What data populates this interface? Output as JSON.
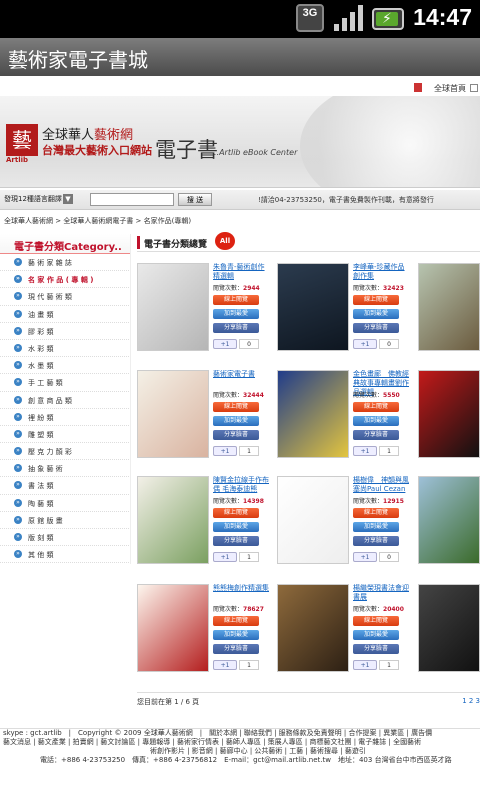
{
  "status_bar": {
    "network": "3G",
    "time": "14:47"
  },
  "app": {
    "title": "藝術家電子書城"
  },
  "top_nav": {
    "home_label": "全球首頁"
  },
  "banner": {
    "logo_text_line1_prefix": "全球華人",
    "logo_text_line1_brand": "藝術網",
    "logo_text_line2": "台灣最大藝術入口網站",
    "logo_small": "Artlib",
    "ebook_title": "電子書",
    "ebook_subtitle": "..Artlib eBook Center"
  },
  "search": {
    "select_value": "發現12種語言翻譯",
    "button_label": "搜 送",
    "phone_notice": "!請洽04-23753250，電子書免費製作刊載，有意將發行"
  },
  "breadcrumb": "全球華人藝術網 > 全球華人藝術網電子書 > 名家作品(專輯)",
  "sidebar": {
    "heading": "電子書分類Category..",
    "items": [
      {
        "label": "藝 術 家 雜 誌",
        "active": false
      },
      {
        "label": "名 家 作 品 ( 專 輯 )",
        "active": true
      },
      {
        "label": "現 代 藝 術 類",
        "active": false
      },
      {
        "label": "油 畫 類",
        "active": false
      },
      {
        "label": "膠 彩 類",
        "active": false
      },
      {
        "label": "水 彩 類",
        "active": false
      },
      {
        "label": "水 墨 類",
        "active": false
      },
      {
        "label": "手 工 藝 類",
        "active": false
      },
      {
        "label": "創 意 商 品 類",
        "active": false
      },
      {
        "label": "裡 紛 類",
        "active": false
      },
      {
        "label": "雕 塑 類",
        "active": false
      },
      {
        "label": "壓 克 力 顏 彩",
        "active": false
      },
      {
        "label": "抽 象 藝 術",
        "active": false
      },
      {
        "label": "書 法 類",
        "active": false
      },
      {
        "label": "陶 藝 類",
        "active": false
      },
      {
        "label": "原 館 版 畫",
        "active": false
      },
      {
        "label": "版 刻 類",
        "active": false
      },
      {
        "label": "其 他 類",
        "active": false
      }
    ]
  },
  "content": {
    "section_title": "電子書分類總覽",
    "all_badge": "All",
    "buttons": {
      "read": "線上閱覽",
      "fav": "加到最愛",
      "fb": "分享臉書",
      "plus": "+1"
    },
    "views_label": "閱覽次數：",
    "books": [
      {
        "title": "朱魯青-藝術創作精選輯",
        "views": "2944",
        "plus_count": "0"
      },
      {
        "title": "李峰華-珍藏作品創作集",
        "views": "32423",
        "plus_count": "0"
      },
      {
        "title": "藝術家電子書",
        "views": "32444",
        "plus_count": "1"
      },
      {
        "title": "金色畫廊　佛教經典故事專輯畫劉作品選輯",
        "views": "5550",
        "plus_count": "1"
      },
      {
        "title": "陳賢金拉線手作布偶 毛海泰迪熊",
        "views": "14398",
        "plus_count": "1"
      },
      {
        "title": "楊樹偉　神韻與風塞尚Paul Cezan",
        "views": "12915",
        "plus_count": "0"
      },
      {
        "title": "熊熊梅創作精選集",
        "views": "78627",
        "plus_count": "1"
      },
      {
        "title": "楊繼榮現書法會迎書展",
        "views": "20400",
        "plus_count": "1"
      }
    ]
  },
  "pager": {
    "info": "您目前在第 1 / 6 頁",
    "pages": "1 2 3"
  },
  "footer": {
    "line1": "skype : gct.artlib　|　Copyright © 2009 全球華人藝術網　|　關於本網 | 聯絡我們 | 服務條款及免責聲明 | 合作提案 | 異業區 | 廣告價",
    "line2": "藝文消息 | 藝文產業 | 拍賣網 | 藝文討論區 | 專題報導 | 藝術家行情表 | 藝師人專區 | 策展人專區 | 商標藝文社團 | 電子雜誌 | 全國藝術",
    "line3": "術創作影片 | 影音網 | 藝廊中心 | 公共藝術 | 工藝 | 藝術搜尋 | 藝遊引",
    "line4": "電話：+886 4-23753250　傳真：+886 4-23756812　E-mail：gct@mail.artlib.net.tw　地址：403 台灣省台中市西區英才路"
  },
  "colors": {
    "accent_red": "#c0122c",
    "link_blue": "#1565c0",
    "titlebar": "#5a5a5a"
  }
}
